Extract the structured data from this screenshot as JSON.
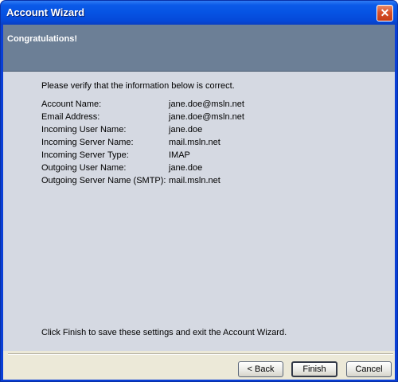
{
  "window": {
    "title": "Account Wizard",
    "close_symbol": "✕"
  },
  "header": {
    "title": "Congratulations!"
  },
  "main": {
    "intro": "Please verify that the information below is correct.",
    "rows": [
      {
        "label": "Account Name:",
        "value": "jane.doe@msln.net"
      },
      {
        "label": "Email Address:",
        "value": "jane.doe@msln.net"
      },
      {
        "label": "Incoming User Name:",
        "value": "jane.doe"
      },
      {
        "label": "Incoming Server Name:",
        "value": "mail.msln.net"
      },
      {
        "label": "Incoming Server Type:",
        "value": "IMAP"
      },
      {
        "label": "Outgoing User Name:",
        "value": "jane.doe"
      },
      {
        "label": "Outgoing Server Name (SMTP):",
        "value": "mail.msln.net"
      }
    ],
    "footer": "Click Finish to save these settings and exit the Account Wizard."
  },
  "buttons": {
    "back": "< Back",
    "finish": "Finish",
    "cancel": "Cancel"
  }
}
